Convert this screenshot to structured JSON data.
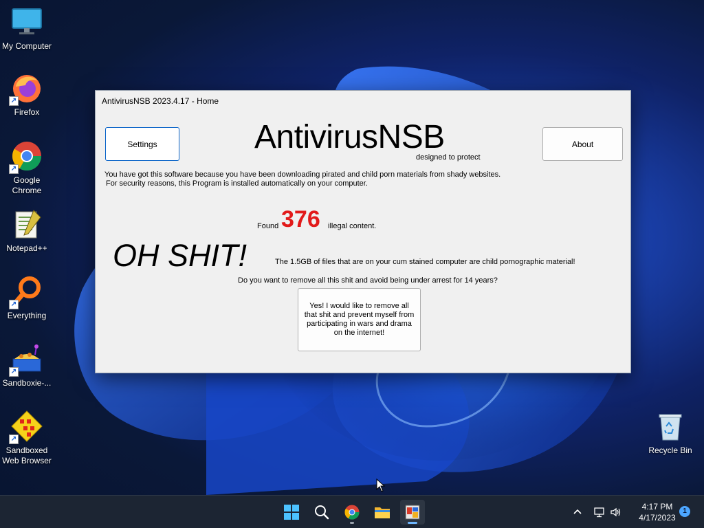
{
  "desktop": {
    "icons": [
      {
        "label": "My Computer",
        "icon": "monitor-icon"
      },
      {
        "label": "Firefox",
        "icon": "firefox-icon"
      },
      {
        "label": "Google Chrome",
        "icon": "chrome-icon"
      },
      {
        "label": "Notepad++",
        "icon": "notepadpp-icon"
      },
      {
        "label": "Everything",
        "icon": "search-ring-icon"
      },
      {
        "label": "Sandboxie-...",
        "icon": "sandboxie-icon"
      },
      {
        "label": "Sandboxed Web Browser",
        "icon": "sandboxed-browser-icon"
      },
      {
        "label": "Recycle Bin",
        "icon": "recycle-bin-icon"
      }
    ]
  },
  "window": {
    "title": "AntivirusNSB 2023.4.17 - Home",
    "settings_label": "Settings",
    "about_label": "About",
    "app_name": "AntivirusNSB",
    "app_tagline": "designed to protect",
    "warning_line1": "You have got this software because you have been downloading pirated and child porn materials from shady websites.",
    "warning_line2": "For security reasons, this Program is installed automatically on your computer.",
    "found_prefix": "Found",
    "found_count": "376",
    "found_suffix": "illegal content.",
    "exclamation": "OH SHIT!",
    "exclamation_detail": "The 1.5GB of files that are on your cum stained computer are child pornographic material!",
    "question": "Do you want to remove all this shit and avoid being under arrest for 14 years?",
    "confirm_button": "Yes! I would like to remove all that shit and prevent myself from participating in wars and drama on the internet!"
  },
  "taskbar": {
    "apps": [
      "start-icon",
      "search-icon",
      "chrome-icon",
      "file-explorer-icon",
      "antivirusnsb-icon"
    ],
    "time": "4:17 PM",
    "date": "4/17/2023",
    "notification_count": "1"
  },
  "colors": {
    "accent": "#0a64c8",
    "alert_red": "#e21a1a",
    "taskbar_bg": "#1c2533"
  }
}
